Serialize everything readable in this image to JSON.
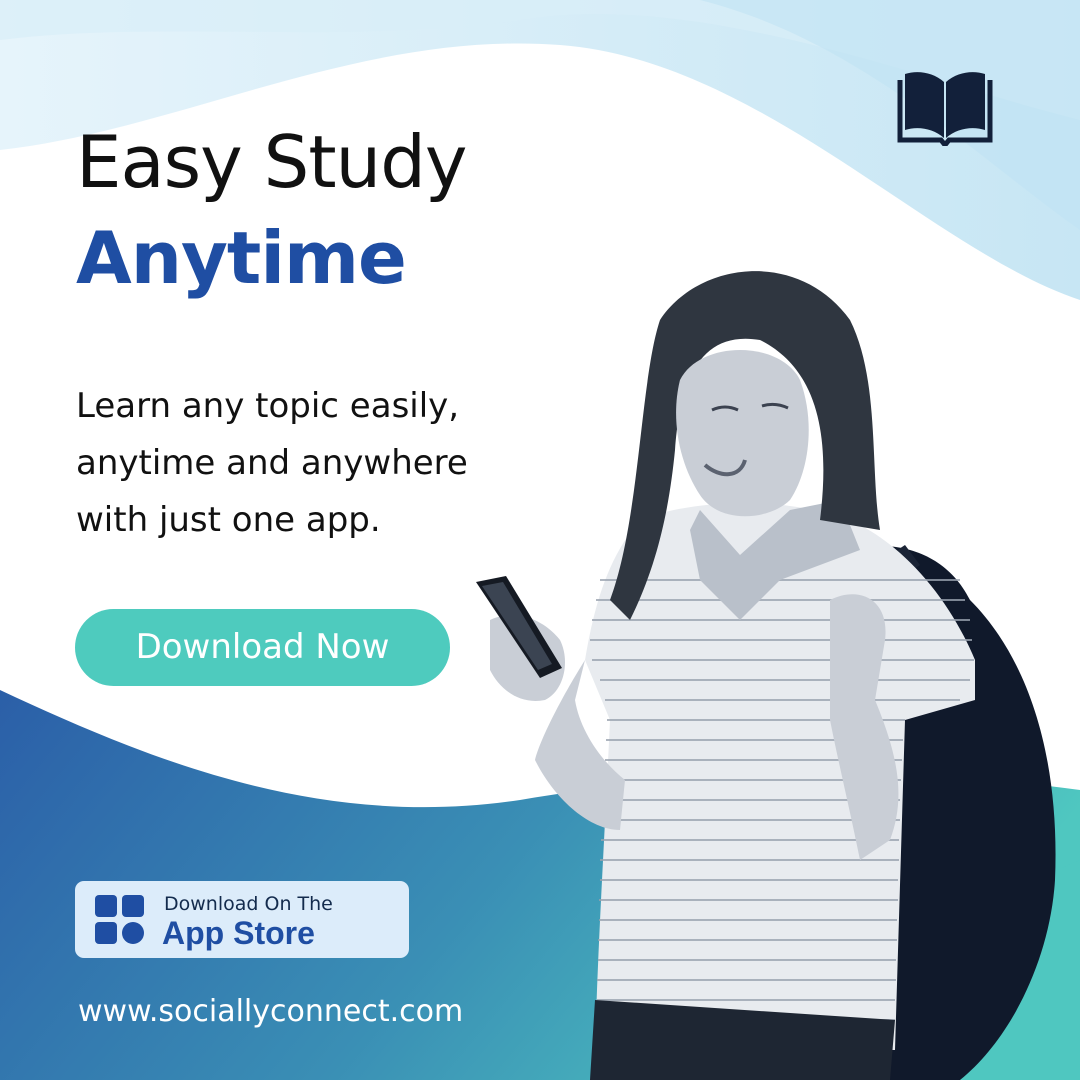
{
  "headline": {
    "line1": "Easy Study",
    "line2": "Anytime"
  },
  "description": "Learn any topic easily, anytime and anywhere with just one app.",
  "cta": {
    "label": "Download Now"
  },
  "store_badge": {
    "small_text": "Download On The",
    "big_text": "App Store",
    "icon": "grid-apps-icon"
  },
  "website": "www.sociallyconnect.com",
  "icons": {
    "top_right": "open-book-icon"
  },
  "colors": {
    "accent_blue": "#1f4ea3",
    "teal": "#4ecbbe",
    "gradient_blue": "#2d67ad",
    "light_blue": "#cfe8f6",
    "dark_navy": "#132b4d"
  }
}
